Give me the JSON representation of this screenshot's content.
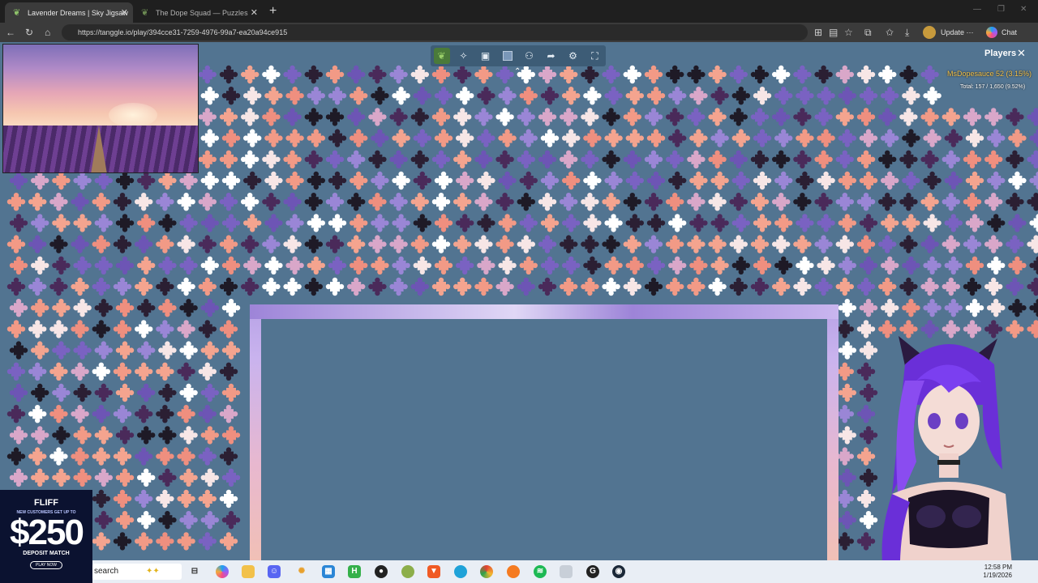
{
  "browser": {
    "tabs": [
      {
        "title": "Lavender Dreams | Sky Jigsaw",
        "active": true
      },
      {
        "title": "The Dope Squad — Puzzles",
        "active": false
      }
    ],
    "url": "https://tanggle.io/play/394cce31-7259-4976-99a7-ea20a94ce915",
    "update_label": "Update",
    "chat_label": "Chat",
    "new_tab_icon": "plus-icon"
  },
  "game": {
    "players_title": "Players",
    "player_entry": "MsDopesauce  52 (3.15%)",
    "total": "Total: 157 / 1,650 (9.52%)",
    "toolbar_icons": [
      "leaf-icon",
      "puzzle-icon",
      "image-icon",
      "background-color-icon",
      "players-icon",
      "share-icon",
      "settings-icon",
      "fullscreen-icon"
    ],
    "colors": {
      "table": "#527491",
      "toolbar": "#3d5c76"
    }
  },
  "ad": {
    "brand": "FLIFF",
    "line1": "NEW CUSTOMERS GET UP TO",
    "amount": "$250",
    "line2": "DEPOSIT MATCH",
    "cta": "PLAY NOW"
  },
  "taskbar": {
    "search_placeholder": "search",
    "time": "12:58 PM",
    "date": "1/19/2026",
    "apps": [
      "task-view-icon",
      "copilot-icon",
      "file-explorer-icon",
      "discord-icon",
      "app-icon",
      "store-icon",
      "app-h-icon",
      "obs-icon",
      "app-icon",
      "brave-icon",
      "edge-icon",
      "chrome-icon",
      "firefox-icon",
      "spotify-icon",
      "app-icon",
      "app-g-icon",
      "steam-icon"
    ]
  }
}
